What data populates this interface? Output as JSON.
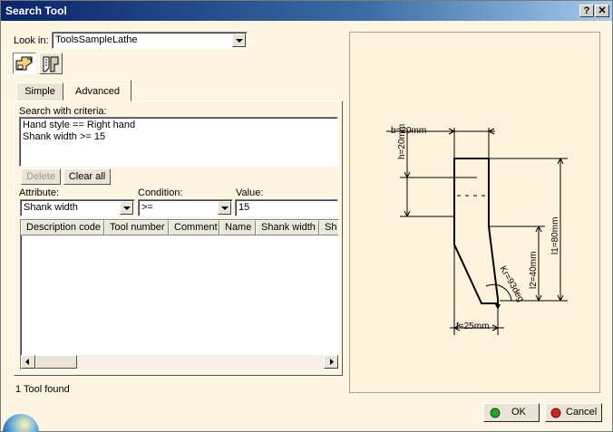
{
  "window": {
    "title": "Search Tool",
    "help_label": "?",
    "close_label": "✕"
  },
  "lookin": {
    "label": "Look in:",
    "value": "ToolsSampleLathe"
  },
  "toolbar": {
    "icon1": "tool-catalog-icon",
    "icon2": "lathe-tool-icon"
  },
  "tabs": [
    {
      "label": "Simple"
    },
    {
      "label": "Advanced"
    }
  ],
  "criteria": {
    "label": "Search with criteria:",
    "lines": [
      "Hand style == Right hand",
      "Shank width >= 15"
    ]
  },
  "buttons": {
    "delete": "Delete",
    "clear_all": "Clear all",
    "ok": "OK",
    "cancel": "Cancel"
  },
  "filters": {
    "attribute_label": "Attribute:",
    "attribute_value": "Shank width",
    "condition_label": "Condition:",
    "condition_value": ">=",
    "value_label": "Value:",
    "value_value": "15"
  },
  "results": {
    "columns": [
      "Description code",
      "Tool number",
      "Comment",
      "Name",
      "Shank width",
      "Sh"
    ],
    "status": "1 Tool found"
  },
  "diagram": {
    "labels": {
      "b": "b=20mm",
      "h": "h=20mm",
      "l1": "l1=80mm",
      "l2": "l2=40mm",
      "kr": "Kr=93deg",
      "f": "f=25mm"
    }
  },
  "colors": {
    "title_start": "#0a246a",
    "title_end": "#a6caf0",
    "panel": "#fdf5e1",
    "ok_icon": "#2aa02a",
    "cancel_icon": "#cc2222"
  }
}
